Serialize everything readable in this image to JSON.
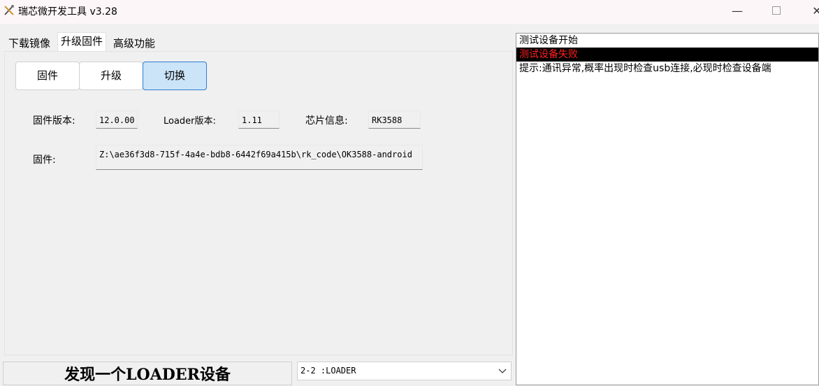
{
  "window": {
    "title": "瑞芯微开发工具 v3.28",
    "minimize_glyph": "—",
    "close_glyph": "✕"
  },
  "tabs": [
    {
      "label": "下载镜像",
      "active": false
    },
    {
      "label": "升级固件",
      "active": true
    },
    {
      "label": "高级功能",
      "active": false
    }
  ],
  "buttons": {
    "firmware": "固件",
    "upgrade": "升级",
    "switch": "切换"
  },
  "info": {
    "fw_version_label": "固件版本:",
    "fw_version_value": "12.0.00",
    "loader_version_label": "Loader版本:",
    "loader_version_value": "1.11",
    "chip_label": "芯片信息:",
    "chip_value": "RK3588",
    "firmware_label": "固件:",
    "firmware_path": "Z:\\ae36f3d8-715f-4a4e-bdb8-6442f69a415b\\rk_code\\OK3588-android"
  },
  "status": {
    "message": "发现一个LOADER设备",
    "device_selected": "2-2 :LOADER"
  },
  "log": [
    {
      "text": "测试设备开始",
      "error": false
    },
    {
      "text": "测试设备失败",
      "error": true
    },
    {
      "text": "提示:通讯异常,概率出现时检查usb连接,必现时检查设备端",
      "error": false
    }
  ],
  "colors": {
    "accent": "#2a7cd0",
    "active_button_bg": "#cce4f7",
    "log_error_text": "#ff2020",
    "log_error_bg": "#000000"
  },
  "icons": {
    "app": "tools-icon",
    "dropdown": "chevron-down-icon"
  }
}
